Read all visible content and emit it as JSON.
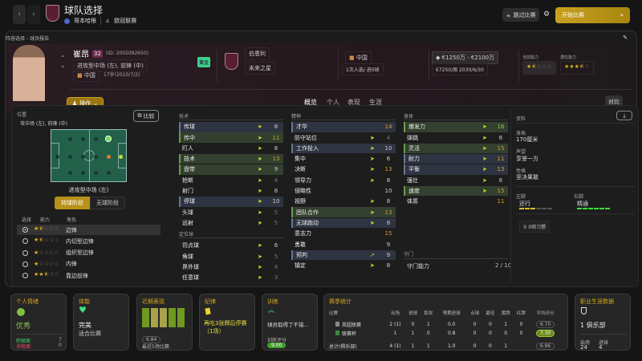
{
  "topbar": {
    "title": "球队选择",
    "club": "哥本哈根",
    "competition": "欧冠联赛",
    "skip_label": "跳过比赛",
    "start_label": "开始比赛"
  },
  "breadcrumb": [
    "阵容选择",
    "球员报告"
  ],
  "player": {
    "name": "崔昂",
    "number": "32",
    "id": "(ID: 2002092650)",
    "positions": "进攻型中场 (左), 前锋 (中)",
    "nation": "中国",
    "age": "17岁(2010/7/2)",
    "tag": "黄金",
    "club": "伯恩利",
    "club_status": "未来之星",
    "intl_nation": "中国",
    "caps": "1次入选/ 进0球",
    "value": "€1250万 - €2100万",
    "wage": "€7250/周",
    "contract": "2030/6/30",
    "current_ability_label": "当前能力",
    "current_ability": 1.5,
    "potential_label": "潜在能力",
    "potential": 3.5
  },
  "actions_label": "操作",
  "tabs": [
    "概览",
    "个人",
    "表现",
    "生涯"
  ],
  "compare_label": "对比",
  "position_panel": {
    "title": "位置",
    "positions": "攻中场 (左), 前锋 (中)",
    "compare_label": "比较",
    "selected_role": "进攻型中场 (左)",
    "phase_on": "持球阶段",
    "phase_off": "无球阶段",
    "col_select": "选择",
    "col_ability": "能力",
    "col_role": "角色",
    "roles": [
      {
        "name": "边锋",
        "stars": 1.5,
        "selected": true
      },
      {
        "name": "内切型边锋",
        "stars": 1.5
      },
      {
        "name": "组织型边锋",
        "stars": 1
      },
      {
        "name": "内锋",
        "stars": 1
      },
      {
        "name": "靠边前锋",
        "stars": 2.5
      }
    ]
  },
  "technical": {
    "title": "技术",
    "attrs": [
      [
        "传球",
        8,
        "b"
      ],
      [
        "传中",
        11,
        "g"
      ],
      [
        "盯人",
        8,
        ""
      ],
      [
        "技术",
        13,
        "g"
      ],
      [
        "盘带",
        9,
        "g"
      ],
      [
        "抢断",
        4,
        ""
      ],
      [
        "射门",
        8,
        ""
      ],
      [
        "停球",
        10,
        "b"
      ],
      [
        "头球",
        5,
        ""
      ],
      [
        "远射",
        5,
        ""
      ]
    ]
  },
  "set_pieces": {
    "title": "定位球",
    "attrs": [
      [
        "罚点球",
        6,
        ""
      ],
      [
        "角球",
        5,
        ""
      ],
      [
        "界外球",
        4,
        ""
      ],
      [
        "任意球",
        3,
        ""
      ]
    ]
  },
  "mental": {
    "title": "精神",
    "attrs": [
      [
        "才华",
        14,
        "b",
        "none"
      ],
      [
        "防守站位",
        4,
        ""
      ],
      [
        "工作投入",
        10,
        "b"
      ],
      [
        "集中",
        6,
        ""
      ],
      [
        "决断",
        13,
        ""
      ],
      [
        "领导力",
        8,
        ""
      ],
      [
        "侵略性",
        10,
        "",
        "none"
      ],
      [
        "视野",
        8,
        ""
      ],
      [
        "团队合作",
        13,
        "g"
      ],
      [
        "无球跑动",
        8,
        "b"
      ],
      [
        "意志力",
        15,
        "",
        "none"
      ],
      [
        "勇敢",
        9,
        "",
        "none"
      ],
      [
        "预判",
        9,
        "b",
        "up"
      ],
      [
        "镇定",
        8,
        ""
      ]
    ]
  },
  "physical": {
    "title": "身体",
    "attrs": [
      [
        "爆发力",
        16,
        "g"
      ],
      [
        "弹跳",
        6,
        ""
      ],
      [
        "灵活",
        15,
        "g"
      ],
      [
        "耐力",
        11,
        "b"
      ],
      [
        "平衡",
        13,
        "b"
      ],
      [
        "强壮",
        6,
        ""
      ],
      [
        "速度",
        15,
        "g"
      ],
      [
        "体质",
        11,
        "",
        "none"
      ]
    ]
  },
  "goalkeeping": {
    "title": "守门",
    "label": "守门能力",
    "value": "2 / 10"
  },
  "info": {
    "title": "资料",
    "height_label": "身高",
    "height": "170厘米",
    "rep_label": "声望",
    "rep": "享誉一方",
    "personality_label": "性格",
    "personality": "坚决果敢",
    "left_label": "左脚",
    "left": "还行",
    "left_level": 3,
    "right_label": "右脚",
    "right": "精通",
    "right_level": 6,
    "habits": "0项习惯"
  },
  "cards": {
    "morale": {
      "title": "个人情绪",
      "value": "优秀",
      "pos_label": "积极面",
      "pos": "7",
      "neg_label": "消极面",
      "neg": "0"
    },
    "fitness": {
      "title": "体能",
      "value": "完美",
      "sub": "适合比赛"
    },
    "form": {
      "title": "近期表现",
      "rating": "6.84",
      "sub": "最近5场比赛",
      "bars": [
        "#6f9a1e",
        "#a8a24a",
        "#a8a24a",
        "#6f9a1e",
        "#6f9a1e"
      ]
    },
    "discipline": {
      "title": "纪律",
      "text": "再吃3张牌后停赛（1场）"
    },
    "training": {
      "title": "训练",
      "text": "球员取得了不错...",
      "score_label": "训练评分",
      "score": "9.00"
    },
    "season": {
      "title": "赛季统计",
      "headers": [
        "比赛",
        "出场",
        "进球",
        "助攻",
        "预期进球",
        "点球",
        "最佳",
        "黄牌",
        "红牌",
        "平均评分"
      ],
      "rows": [
        [
          "英超联赛",
          "2 (1)",
          "0",
          "1",
          "0.0",
          "0",
          "0",
          "1",
          "0",
          "6.70"
        ],
        [
          "联赛杯",
          "1",
          "1",
          "0",
          "0.8",
          "0",
          "0",
          "0",
          "0",
          "7.30"
        ],
        [
          "总计(俱乐部)",
          "4 (1)",
          "1",
          "1",
          "1.0",
          "0",
          "0",
          "1",
          "",
          "6.96"
        ]
      ]
    },
    "career": {
      "title": "职业生涯数据",
      "clubs": "1 俱乐部",
      "apps_label": "出场",
      "apps": "24",
      "goals_label": "进球",
      "goals": "4"
    }
  }
}
